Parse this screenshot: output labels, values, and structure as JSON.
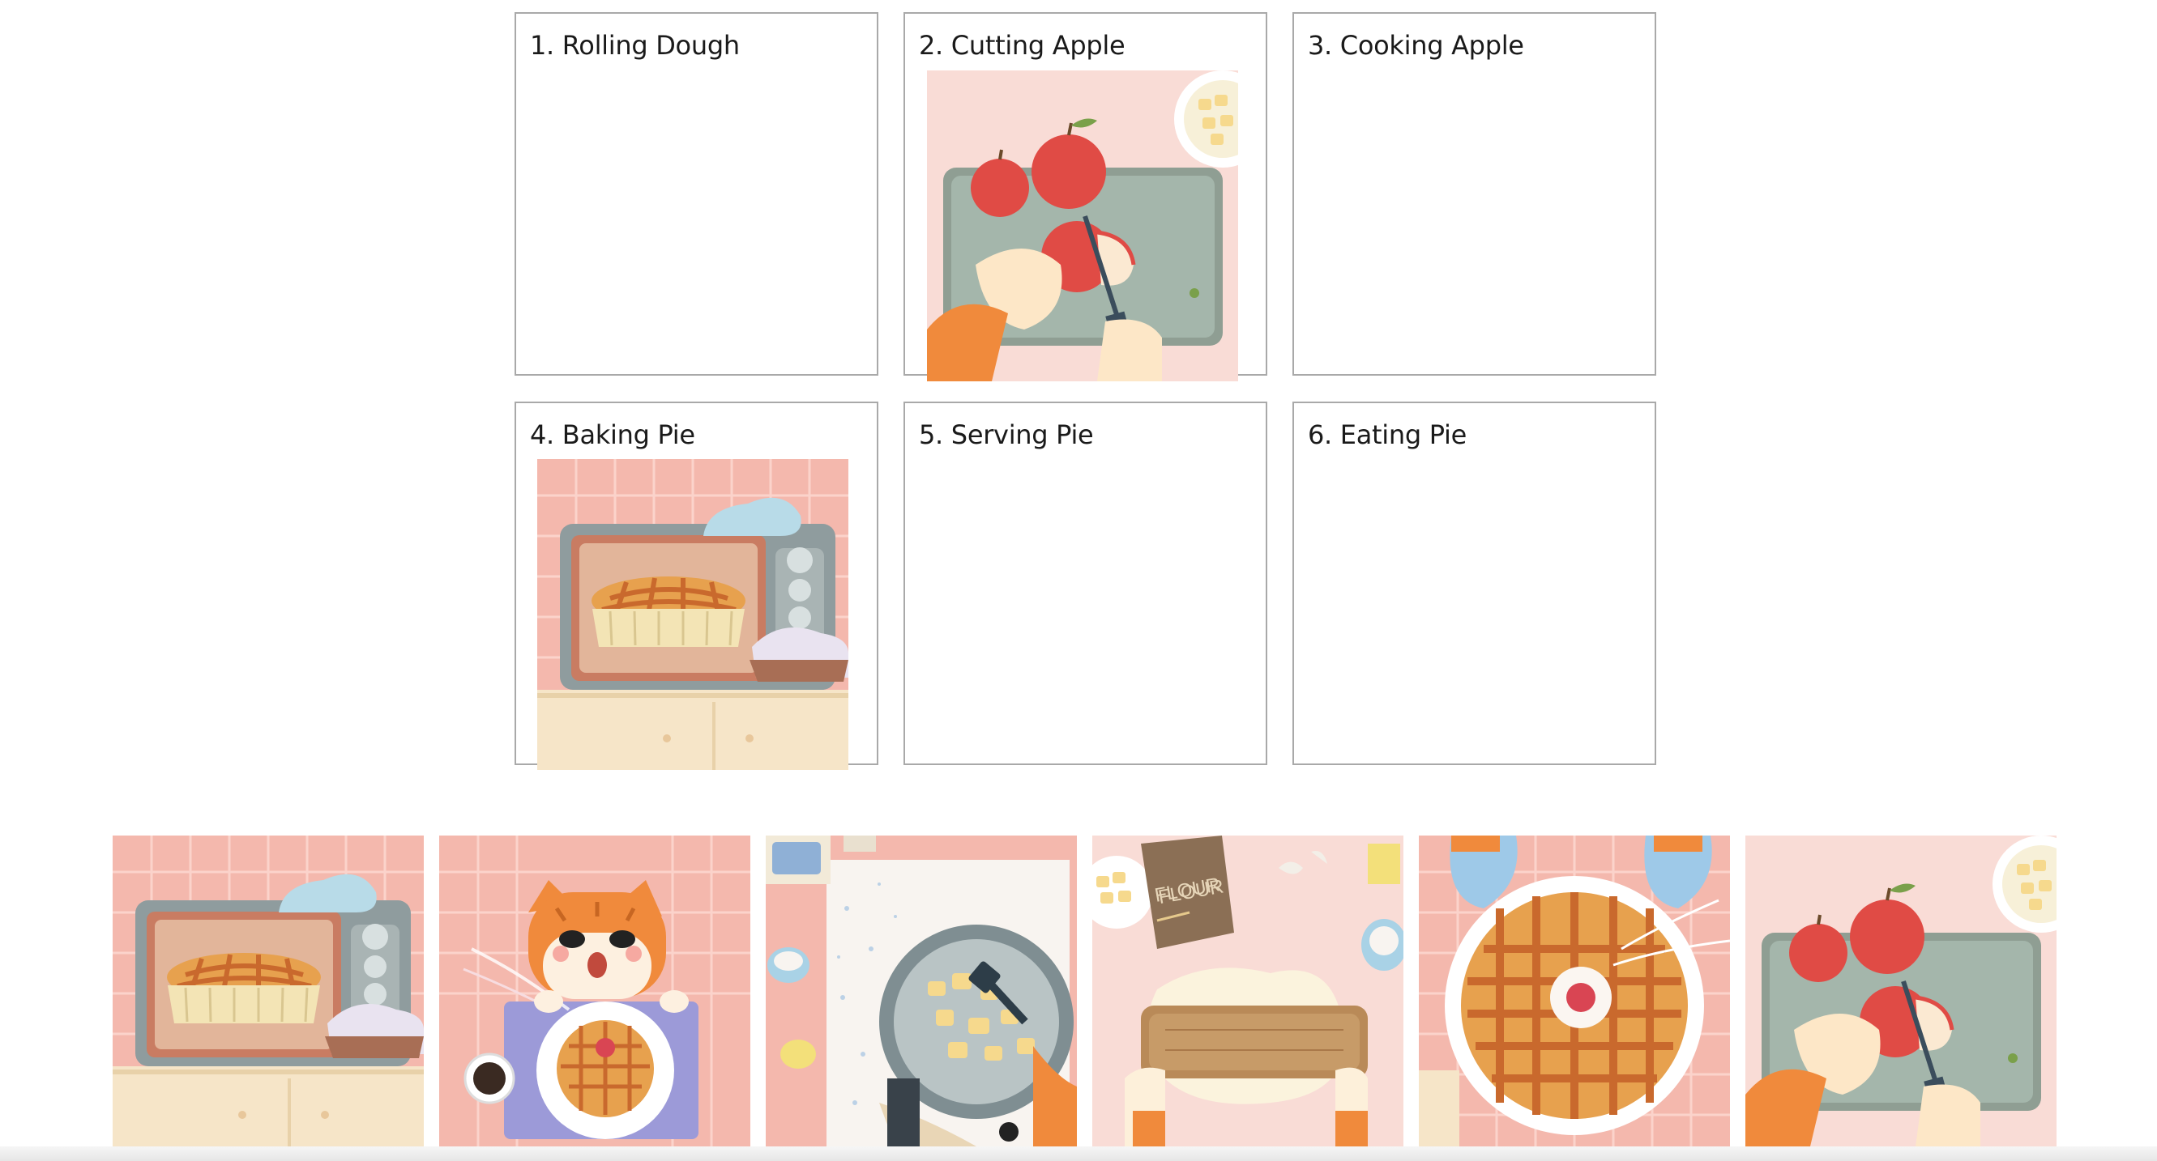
{
  "slots": [
    {
      "label": "1. Rolling Dough"
    },
    {
      "label": "2. Cutting Apple"
    },
    {
      "label": "3. Cooking Apple"
    },
    {
      "label": "4. Baking Pie"
    },
    {
      "label": "5. Serving Pie"
    },
    {
      "label": "6. Eating Pie"
    }
  ],
  "cards": {
    "baking": {
      "icon": "oven-pie-illustration"
    },
    "eating": {
      "icon": "cat-eating-pie-illustration"
    },
    "cooking": {
      "icon": "pan-cooking-apples-illustration"
    },
    "rolling": {
      "icon": "rolling-dough-illustration",
      "flour_bag_text": "FLOUR"
    },
    "serving": {
      "icon": "pie-with-oven-mitts-illustration"
    },
    "cutting": {
      "icon": "cutting-apple-illustration"
    }
  },
  "colors": {
    "slot_border": "#a9a9a9",
    "tile_pink": "#f4b8ad",
    "background_pink": "#fbdcd5",
    "oven_gray": "#8f9c9e",
    "crust": "#e7a14e",
    "orange_fur": "#f08a3c"
  }
}
